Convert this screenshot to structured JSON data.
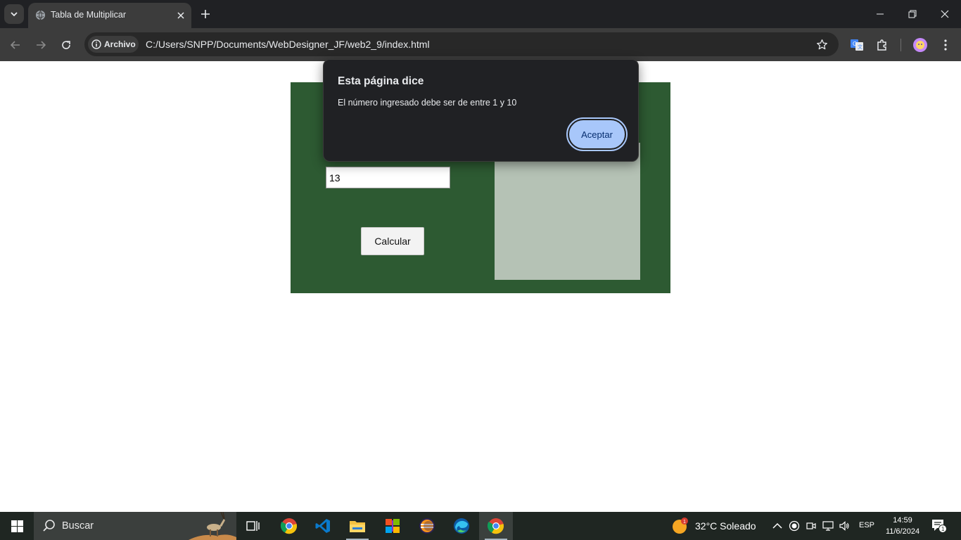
{
  "browser": {
    "tab_title": "Tabla de Multiplicar",
    "security_chip": "Archivo",
    "url": "C:/Users/SNPP/Documents/WebDesigner_JF/web2_9/index.html"
  },
  "page": {
    "number_input_value": "13",
    "calculate_button": "Calcular"
  },
  "dialog": {
    "title": "Esta página dice",
    "message": "El número ingresado debe ser de entre 1 y 10",
    "ok_button": "Aceptar"
  },
  "taskbar": {
    "search_label": "Buscar",
    "weather": "32°C  Soleado",
    "weather_badge": "1",
    "language": "ESP",
    "time": "14:59",
    "date": "11/6/2024",
    "notification_count": "1",
    "apps": [
      "chrome",
      "vscode",
      "file-explorer",
      "windows-store",
      "eclipse",
      "edge",
      "chrome-active"
    ]
  },
  "colors": {
    "panel_green": "#2d5a32",
    "result_box": "#b5c2b5",
    "dialog_bg": "#202124",
    "dialog_button": "#a8c7fa"
  }
}
